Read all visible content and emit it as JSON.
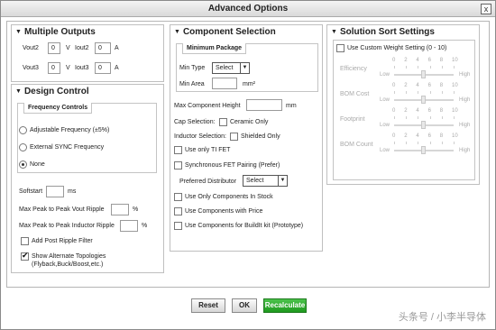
{
  "window": {
    "title": "Advanced Options",
    "close": "x"
  },
  "outputs": {
    "header": "Multiple Outputs",
    "vout2_label": "Vout2",
    "vout2_value": "0",
    "vout2_unit": "V",
    "iout2_label": "Iout2",
    "iout2_value": "0",
    "iout2_unit": "A",
    "vout3_label": "Vout3",
    "vout3_value": "0",
    "vout3_unit": "V",
    "iout3_label": "Iout3",
    "iout3_value": "0",
    "iout3_unit": "A"
  },
  "design": {
    "header": "Design Control",
    "freq_title": "Frequency Controls",
    "freq_options": [
      "Adjustable Frequency (±5%)",
      "External SYNC Frequency",
      "None"
    ],
    "softstart_label": "Softstart",
    "softstart_unit": "ms",
    "vout_ripple_label": "Max Peak to Peak Vout Ripple",
    "vout_ripple_unit": "%",
    "ind_ripple_label": "Max Peak to Peak Inductor Ripple",
    "ind_ripple_unit": "%",
    "post_ripple_label": "Add Post Ripple Filter",
    "alt_topo_label": "Show Alternate Topologies",
    "alt_topo_sub": "(Flyback,Buck/Boost,etc.)"
  },
  "component": {
    "header": "Component Selection",
    "min_pkg_title": "Minimum Package",
    "min_type_label": "Min Type",
    "min_type_value": "Select",
    "min_area_label": "Min Area",
    "min_area_unit": "mm²",
    "max_height_label": "Max Component Height",
    "max_height_unit": "mm",
    "cap_sel_label": "Cap Selection:",
    "ceramic_label": "Ceramic Only",
    "ind_sel_label": "Inductor Selection:",
    "shielded_label": "Shielded Only",
    "ti_fet_label": "Use only TI FET",
    "sync_fet_label": "Synchronous FET Pairing (Prefer)",
    "distributor_label": "Preferred Distributor",
    "distributor_value": "Select",
    "in_stock_label": "Use Only Components In Stock",
    "with_price_label": "Use Components with Price",
    "buildit_label": "Use Components for BuildIt kit (Prototype)"
  },
  "solution": {
    "header": "Solution Sort Settings",
    "custom_weight_label": "Use Custom Weight Setting (0 - 10)",
    "scale_ticks": [
      "0",
      "2",
      "4",
      "6",
      "8",
      "10"
    ],
    "low": "Low",
    "high": "High",
    "sliders": [
      {
        "label": "Efficiency",
        "value": 5
      },
      {
        "label": "BOM Cost",
        "value": 5
      },
      {
        "label": "Footprint",
        "value": 5
      },
      {
        "label": "BOM Count",
        "value": 5
      }
    ]
  },
  "footer": {
    "reset": "Reset",
    "ok": "OK",
    "recalculate": "Recalculate"
  },
  "watermark": "头条号 / 小李半导体"
}
